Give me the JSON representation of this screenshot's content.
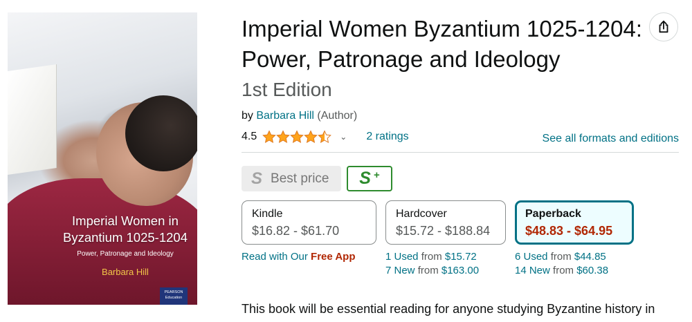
{
  "cover": {
    "title": "Imperial Women in Byzantium 1025-1204",
    "subtitle": "Power, Patronage and Ideology",
    "author": "Barbara Hill",
    "publisher_line1": "PEARSON",
    "publisher_line2": "Education"
  },
  "product": {
    "title": "Imperial Women Byzantium 1025-1204: Power, Patronage and Ideology",
    "edition": "1st Edition",
    "by_prefix": "by",
    "author": "Barbara Hill",
    "author_role": "(Author)",
    "rating_value": "4.5",
    "rating_stars": 4.5,
    "ratings_link": "2 ratings",
    "see_all_formats": "See all formats and editions"
  },
  "price_badges": {
    "best_price_icon": "S",
    "best_price_label": "Best price",
    "s_plus_icon": "S",
    "s_plus_plus": "+"
  },
  "formats": [
    {
      "name": "Kindle",
      "price": "$16.82 - $61.70",
      "selected": false
    },
    {
      "name": "Hardcover",
      "price": "$15.72 - $188.84",
      "selected": false
    },
    {
      "name": "Paperback",
      "price": "$48.83 - $64.95",
      "selected": true
    }
  ],
  "kindle_extra": {
    "prefix": "Read with Our",
    "link": "Free App"
  },
  "hardcover_offers": [
    {
      "count": "1 Used",
      "from": "from",
      "price": "$15.72"
    },
    {
      "count": "7 New",
      "from": "from",
      "price": "$163.00"
    }
  ],
  "paperback_offers": [
    {
      "count": "6 Used",
      "from": "from",
      "price": "$44.85"
    },
    {
      "count": "14 New",
      "from": "from",
      "price": "$60.38"
    }
  ],
  "description_start": "This book will be essential reading for anyone studying Byzantine history in",
  "colors": {
    "link": "#007185",
    "price_red": "#b12704",
    "star": "#ffa41c",
    "selected_border": "#007185",
    "s_plus_green": "#2e8b2e"
  }
}
